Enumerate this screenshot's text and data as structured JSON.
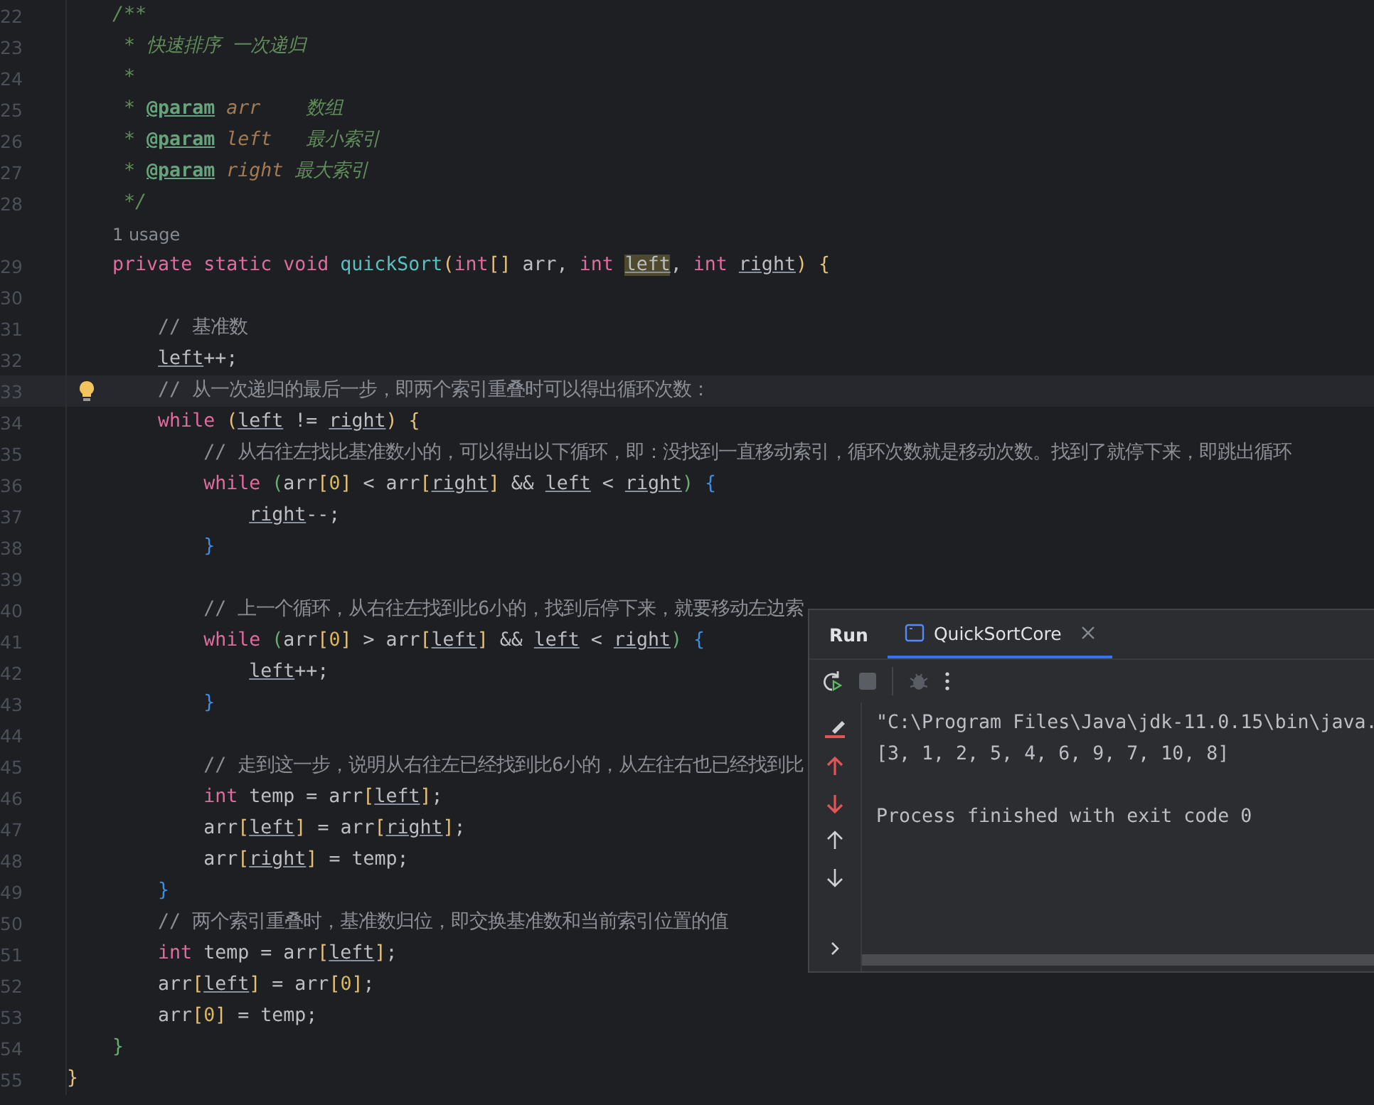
{
  "editor": {
    "lines": [
      {
        "number": "22",
        "current": false,
        "tokens": [
          {
            "kind": "doc",
            "text": "    /**"
          }
        ]
      },
      {
        "number": "23",
        "current": false,
        "tokens": [
          {
            "kind": "doc",
            "text": "     * 快速排序 一次递归"
          }
        ]
      },
      {
        "number": "24",
        "current": false,
        "tokens": [
          {
            "kind": "doc",
            "text": "     *"
          }
        ]
      },
      {
        "number": "25",
        "current": false,
        "tokens": [
          {
            "kind": "doc",
            "text": "     * "
          },
          {
            "kind": "tag",
            "text": "@param"
          },
          {
            "kind": "param",
            "text": " arr"
          },
          {
            "kind": "doc",
            "text": "    数组"
          }
        ]
      },
      {
        "number": "26",
        "current": false,
        "tokens": [
          {
            "kind": "doc",
            "text": "     * "
          },
          {
            "kind": "tag",
            "text": "@param"
          },
          {
            "kind": "param",
            "text": " left"
          },
          {
            "kind": "doc",
            "text": "   最小索引"
          }
        ]
      },
      {
        "number": "27",
        "current": false,
        "tokens": [
          {
            "kind": "doc",
            "text": "     * "
          },
          {
            "kind": "tag",
            "text": "@param"
          },
          {
            "kind": "param",
            "text": " right"
          },
          {
            "kind": "doc",
            "text": " 最大索引"
          }
        ]
      },
      {
        "number": "28",
        "current": false,
        "tokens": [
          {
            "kind": "doc",
            "text": "     */"
          }
        ]
      },
      {
        "kind": "hint",
        "text": "1 usage"
      },
      {
        "number": "29",
        "current": false,
        "tokens": [
          {
            "kind": "kw",
            "text": "    private static void "
          },
          {
            "kind": "fn",
            "text": "quickSort"
          },
          {
            "kind": "bracket1",
            "text": "("
          },
          {
            "kind": "kw",
            "text": "int"
          },
          {
            "kind": "bracket1",
            "text": "[]"
          },
          {
            "kind": "plain",
            "text": " arr, "
          },
          {
            "kind": "kw",
            "text": "int "
          },
          {
            "kind": "var-hl",
            "text": "left"
          },
          {
            "kind": "plain",
            "text": ", "
          },
          {
            "kind": "kw",
            "text": "int "
          },
          {
            "kind": "var",
            "text": "right"
          },
          {
            "kind": "bracket1",
            "text": ")"
          },
          {
            "kind": "bracket1",
            "text": " {"
          }
        ]
      },
      {
        "number": "30",
        "current": false
      },
      {
        "number": "31",
        "current": false,
        "tokens": [
          {
            "kind": "comment",
            "text": "        // 基准数"
          }
        ]
      },
      {
        "number": "32",
        "current": false,
        "tokens": [
          {
            "kind": "var",
            "text": "        left"
          },
          {
            "kind": "plain",
            "text": "++;"
          }
        ]
      },
      {
        "number": "33",
        "current": true,
        "tokens": [
          {
            "kind": "comment",
            "text": "        // 从一次递归的最后一步，即两个索引重叠时可以得出循环次数："
          }
        ]
      },
      {
        "number": "34",
        "current": false,
        "tokens": [
          {
            "kind": "kw",
            "text": "        while "
          },
          {
            "kind": "bracket1",
            "text": "("
          },
          {
            "kind": "var",
            "text": "left"
          },
          {
            "kind": "plain",
            "text": " != "
          },
          {
            "kind": "var",
            "text": "right"
          },
          {
            "kind": "bracket1",
            "text": ")"
          },
          {
            "kind": "bracket1",
            "text": " {"
          }
        ]
      },
      {
        "number": "35",
        "current": false,
        "tokens": [
          {
            "kind": "comment",
            "text": "            // 从右往左找比基准数小的，可以得出以下循环，即：没找到一直移动索引，循环次数就是移动次数。找到了就停下来，即跳出循环"
          }
        ]
      },
      {
        "number": "36",
        "current": false,
        "tokens": [
          {
            "kind": "kw",
            "text": "            while "
          },
          {
            "kind": "bracket2",
            "text": "("
          },
          {
            "kind": "plain",
            "text": "arr"
          },
          {
            "kind": "bracket1",
            "text": "["
          },
          {
            "kind": "num",
            "text": "0"
          },
          {
            "kind": "bracket1",
            "text": "]"
          },
          {
            "kind": "plain",
            "text": " < arr"
          },
          {
            "kind": "bracket1",
            "text": "["
          },
          {
            "kind": "var",
            "text": "right"
          },
          {
            "kind": "bracket1",
            "text": "]"
          },
          {
            "kind": "plain",
            "text": " && "
          },
          {
            "kind": "var",
            "text": "left"
          },
          {
            "kind": "plain",
            "text": " < "
          },
          {
            "kind": "var",
            "text": "right"
          },
          {
            "kind": "bracket2",
            "text": ")"
          },
          {
            "kind": "bracket3",
            "text": " {"
          }
        ]
      },
      {
        "number": "37",
        "current": false,
        "tokens": [
          {
            "kind": "var",
            "text": "                right"
          },
          {
            "kind": "plain",
            "text": "--;"
          }
        ]
      },
      {
        "number": "38",
        "current": false,
        "tokens": [
          {
            "kind": "bracket3",
            "text": "            }"
          }
        ]
      },
      {
        "number": "39",
        "current": false
      },
      {
        "number": "40",
        "current": false,
        "tokens": [
          {
            "kind": "comment",
            "text": "            // 上一个循环，从右往左找到比6小的，找到后停下来，就要移动左边索"
          }
        ]
      },
      {
        "number": "41",
        "current": false,
        "tokens": [
          {
            "kind": "kw",
            "text": "            while "
          },
          {
            "kind": "bracket2",
            "text": "("
          },
          {
            "kind": "plain",
            "text": "arr"
          },
          {
            "kind": "bracket1",
            "text": "["
          },
          {
            "kind": "num",
            "text": "0"
          },
          {
            "kind": "bracket1",
            "text": "]"
          },
          {
            "kind": "plain",
            "text": " > arr"
          },
          {
            "kind": "bracket1",
            "text": "["
          },
          {
            "kind": "var",
            "text": "left"
          },
          {
            "kind": "bracket1",
            "text": "]"
          },
          {
            "kind": "plain",
            "text": " && "
          },
          {
            "kind": "var",
            "text": "left"
          },
          {
            "kind": "plain",
            "text": " < "
          },
          {
            "kind": "var",
            "text": "right"
          },
          {
            "kind": "bracket2",
            "text": ")"
          },
          {
            "kind": "bracket3",
            "text": " {"
          }
        ]
      },
      {
        "number": "42",
        "current": false,
        "tokens": [
          {
            "kind": "var",
            "text": "                left"
          },
          {
            "kind": "plain",
            "text": "++;"
          }
        ]
      },
      {
        "number": "43",
        "current": false,
        "tokens": [
          {
            "kind": "bracket3",
            "text": "            }"
          }
        ]
      },
      {
        "number": "44",
        "current": false
      },
      {
        "number": "45",
        "current": false,
        "tokens": [
          {
            "kind": "comment",
            "text": "            // 走到这一步，说明从右往左已经找到比6小的，从左往右也已经找到比"
          }
        ]
      },
      {
        "number": "46",
        "current": false,
        "tokens": [
          {
            "kind": "kw",
            "text": "            int "
          },
          {
            "kind": "plain",
            "text": "temp = arr"
          },
          {
            "kind": "bracket1",
            "text": "["
          },
          {
            "kind": "var",
            "text": "left"
          },
          {
            "kind": "bracket1",
            "text": "]"
          },
          {
            "kind": "plain",
            "text": ";"
          }
        ]
      },
      {
        "number": "47",
        "current": false,
        "tokens": [
          {
            "kind": "plain",
            "text": "            arr"
          },
          {
            "kind": "bracket1",
            "text": "["
          },
          {
            "kind": "var",
            "text": "left"
          },
          {
            "kind": "bracket1",
            "text": "]"
          },
          {
            "kind": "plain",
            "text": " = arr"
          },
          {
            "kind": "bracket1",
            "text": "["
          },
          {
            "kind": "var",
            "text": "right"
          },
          {
            "kind": "bracket1",
            "text": "]"
          },
          {
            "kind": "plain",
            "text": ";"
          }
        ]
      },
      {
        "number": "48",
        "current": false,
        "tokens": [
          {
            "kind": "plain",
            "text": "            arr"
          },
          {
            "kind": "bracket1",
            "text": "["
          },
          {
            "kind": "var",
            "text": "right"
          },
          {
            "kind": "bracket1",
            "text": "]"
          },
          {
            "kind": "plain",
            "text": " = temp;"
          }
        ]
      },
      {
        "number": "49",
        "current": false,
        "tokens": [
          {
            "kind": "bracket3",
            "text": "        }"
          }
        ]
      },
      {
        "number": "50",
        "current": false,
        "tokens": [
          {
            "kind": "comment",
            "text": "        // 两个索引重叠时，基准数归位，即交换基准数和当前索引位置的值"
          }
        ]
      },
      {
        "number": "51",
        "current": false,
        "tokens": [
          {
            "kind": "kw",
            "text": "        int "
          },
          {
            "kind": "plain",
            "text": "temp = arr"
          },
          {
            "kind": "bracket1",
            "text": "["
          },
          {
            "kind": "var",
            "text": "left"
          },
          {
            "kind": "bracket1",
            "text": "]"
          },
          {
            "kind": "plain",
            "text": ";"
          }
        ]
      },
      {
        "number": "52",
        "current": false,
        "tokens": [
          {
            "kind": "plain",
            "text": "        arr"
          },
          {
            "kind": "bracket1",
            "text": "["
          },
          {
            "kind": "var",
            "text": "left"
          },
          {
            "kind": "bracket1",
            "text": "]"
          },
          {
            "kind": "plain",
            "text": " = arr"
          },
          {
            "kind": "bracket1",
            "text": "["
          },
          {
            "kind": "num",
            "text": "0"
          },
          {
            "kind": "bracket1",
            "text": "]"
          },
          {
            "kind": "plain",
            "text": ";"
          }
        ]
      },
      {
        "number": "53",
        "current": false,
        "tokens": [
          {
            "kind": "plain",
            "text": "        arr"
          },
          {
            "kind": "bracket1",
            "text": "["
          },
          {
            "kind": "num",
            "text": "0"
          },
          {
            "kind": "bracket1",
            "text": "]"
          },
          {
            "kind": "plain",
            "text": " = temp;"
          }
        ]
      },
      {
        "number": "54",
        "current": false,
        "tokens": [
          {
            "kind": "bracket2",
            "text": "    }"
          }
        ]
      },
      {
        "number": "55",
        "current": false,
        "tokens": [
          {
            "kind": "bracket1",
            "text": "}"
          }
        ]
      }
    ]
  },
  "run_panel": {
    "title": "Run",
    "tabs": [
      {
        "label": "QuickSortCore",
        "selected": true
      }
    ],
    "console": {
      "command": "\"C:\\Program Files\\Java\\jdk-11.0.15\\bin\\java.",
      "output": "[3, 1, 2, 5, 4, 6, 9, 7, 10, 8]",
      "exit_message": "Process finished with exit code 0"
    }
  }
}
